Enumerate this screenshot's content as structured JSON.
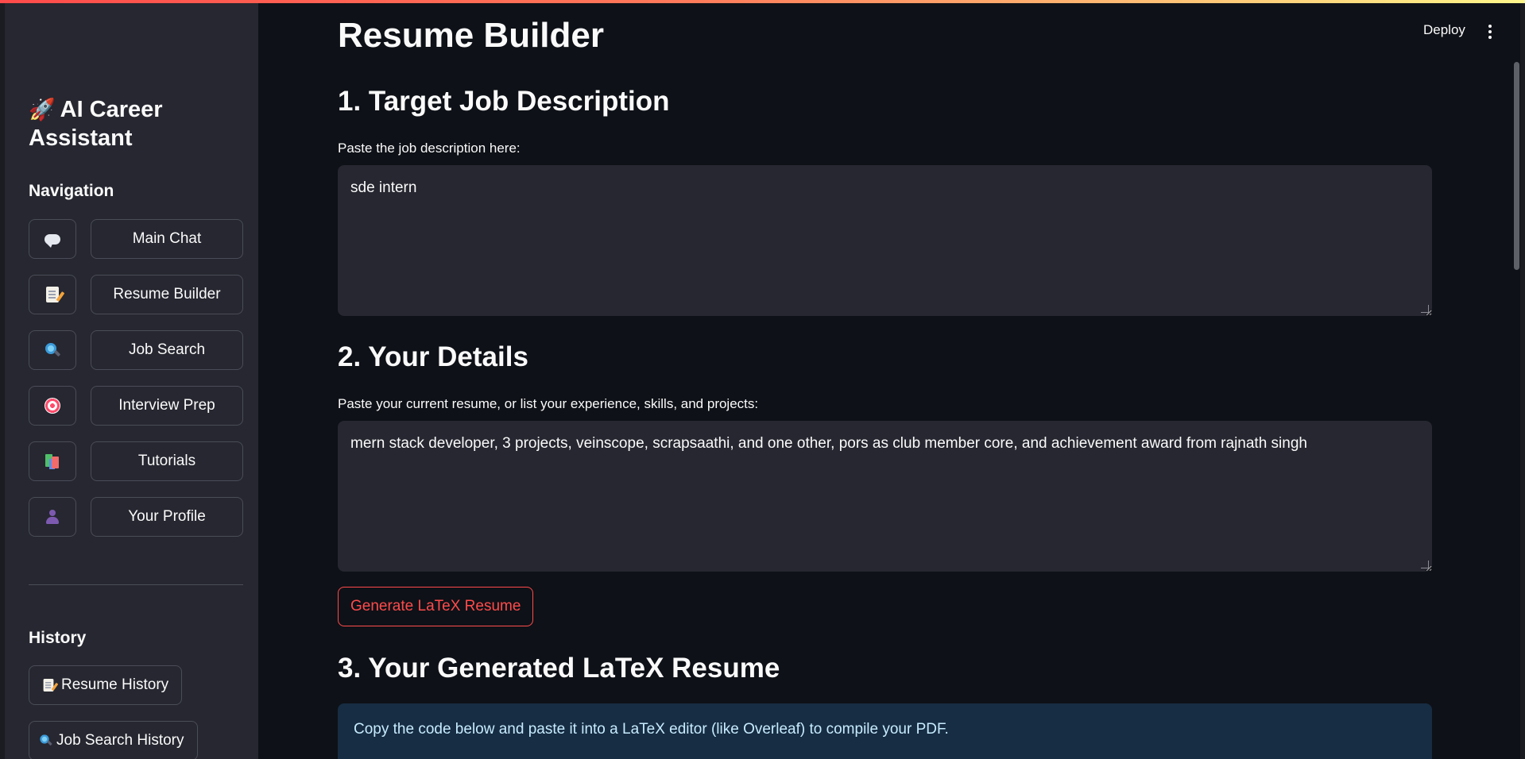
{
  "header": {
    "deploy_label": "Deploy",
    "menu_icon": "vertical-dots-icon"
  },
  "sidebar": {
    "title_emoji": "🚀",
    "title": "AI Career Assistant",
    "nav_heading": "Navigation",
    "nav_items": [
      {
        "icon": "speech-bubble-icon",
        "label": "Main Chat"
      },
      {
        "icon": "memo-icon",
        "label": "Resume Builder"
      },
      {
        "icon": "magnifier-icon",
        "label": "Job Search"
      },
      {
        "icon": "target-icon",
        "label": "Interview Prep"
      },
      {
        "icon": "books-icon",
        "label": "Tutorials"
      },
      {
        "icon": "user-silhouette-icon",
        "label": "Your Profile"
      }
    ],
    "history_heading": "History",
    "history_items": [
      {
        "icon": "memo-icon",
        "label": "Resume History"
      },
      {
        "icon": "magnifier-icon",
        "label": "Job Search History"
      }
    ]
  },
  "main": {
    "title": "Resume Builder",
    "section1": {
      "heading": "1. Target Job Description",
      "label": "Paste the job description here:",
      "value": "sde intern"
    },
    "section2": {
      "heading": "2. Your Details",
      "label": "Paste your current resume, or list your experience, skills, and projects:",
      "value": "mern stack developer, 3 projects, veinscope, scrapsaathi, and one other, pors as club member core, and achievement award from rajnath singh"
    },
    "generate_label": "Generate LaTeX Resume",
    "section3": {
      "heading": "3. Your Generated LaTeX Resume",
      "info": "Copy the code below and paste it into a LaTeX editor (like Overleaf) to compile your PDF."
    }
  },
  "colors": {
    "background": "#0e1117",
    "sidebar": "#262730",
    "accent": "#ff4b4b",
    "info_bg": "#172d43",
    "info_text": "#c7ebff"
  }
}
